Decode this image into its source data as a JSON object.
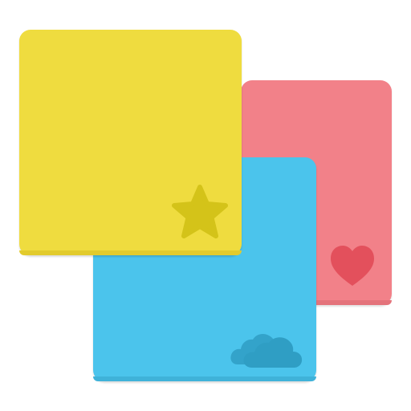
{
  "cards": [
    {
      "id": "red",
      "color": "#f28189",
      "shade": "#e4737b",
      "icon": "heart-icon",
      "icon_color": "#e3505c"
    },
    {
      "id": "blue",
      "color": "#4bc4ec",
      "shade": "#3fb2d9",
      "icon": "cloud-icon",
      "icon_color": "#2f9ec4"
    },
    {
      "id": "yellow",
      "color": "#efdc3f",
      "shade": "#e2cb2d",
      "icon": "star-icon",
      "icon_color": "#d4c319"
    }
  ]
}
